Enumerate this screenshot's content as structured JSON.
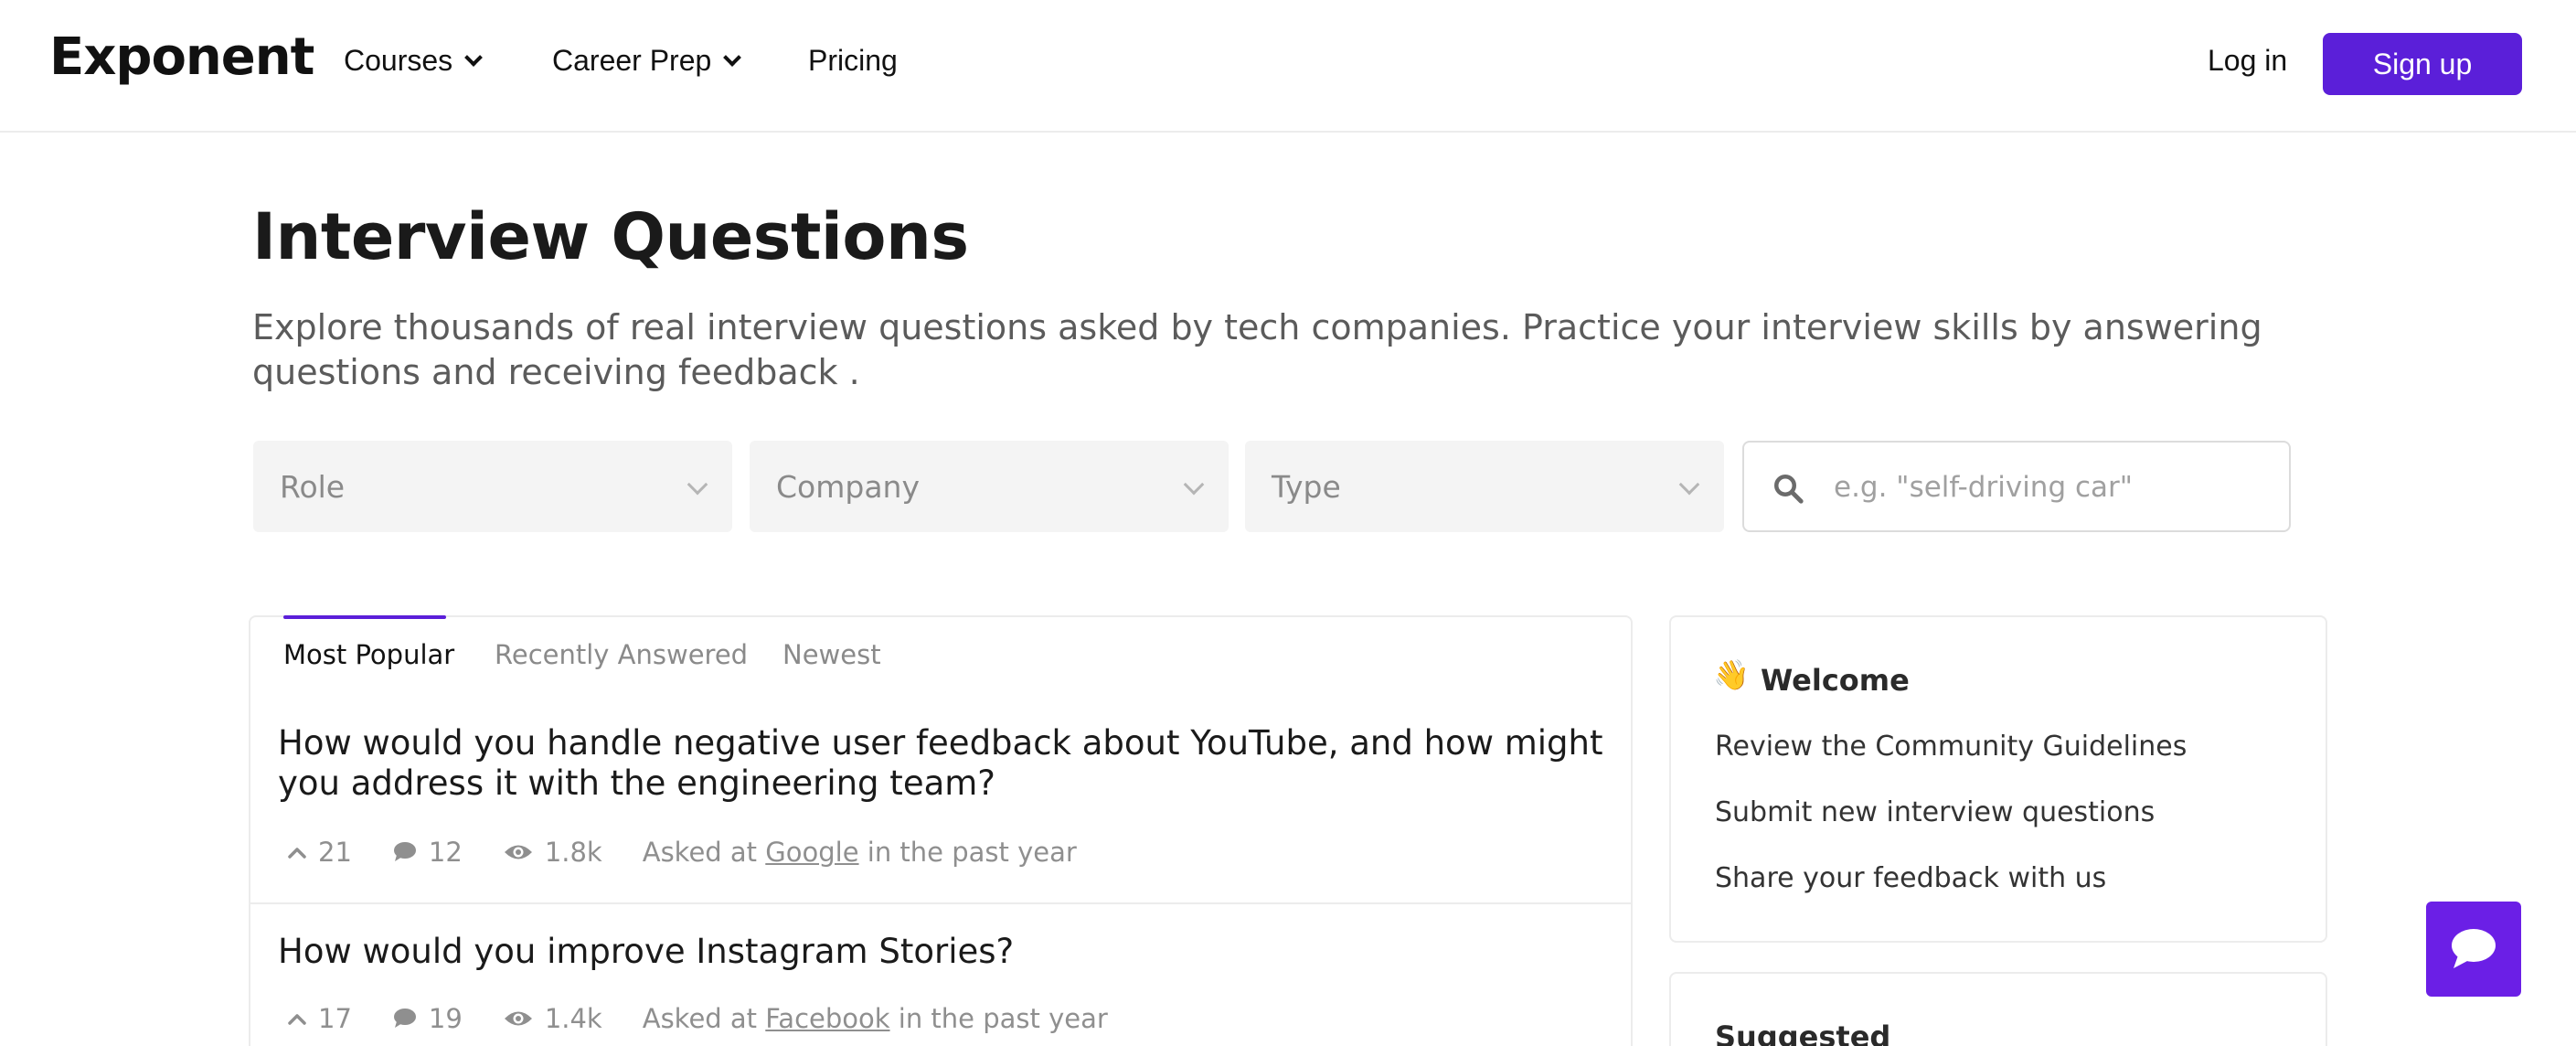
{
  "header": {
    "logo": "Exponent",
    "nav": [
      {
        "label": "Courses"
      },
      {
        "label": "Career Prep"
      },
      {
        "label": "Pricing"
      }
    ],
    "login": "Log in",
    "signup": "Sign up"
  },
  "page": {
    "title": "Interview Questions",
    "description": "Explore thousands of real interview questions asked by tech companies. Practice your interview skills by answering questions and receiving feedback ."
  },
  "filters": {
    "role": "Role",
    "company": "Company",
    "type": "Type",
    "search_placeholder": "e.g. \"self-driving car\""
  },
  "tabs": [
    "Most Popular",
    "Recently Answered",
    "Newest"
  ],
  "questions": [
    {
      "title": "How would you handle negative user feedback about YouTube, and how might you address it with the engineering team?",
      "upvotes": "21",
      "comments": "12",
      "views": "1.8k",
      "asked_prefix": "Asked at",
      "company": "Google",
      "when": "in the past year"
    },
    {
      "title": "How would you improve Instagram Stories?",
      "upvotes": "17",
      "comments": "19",
      "views": "1.4k",
      "asked_prefix": "Asked at",
      "company": "Facebook",
      "when": "in the past year"
    }
  ],
  "welcome": {
    "emoji": "👋",
    "title": "Welcome",
    "links": [
      "Review the Community Guidelines",
      "Submit new interview questions",
      "Share your feedback with us"
    ]
  },
  "suggested": {
    "title": "Suggested"
  },
  "colors": {
    "accent": "#5b1fd9",
    "chat": "#6b1fe6"
  }
}
